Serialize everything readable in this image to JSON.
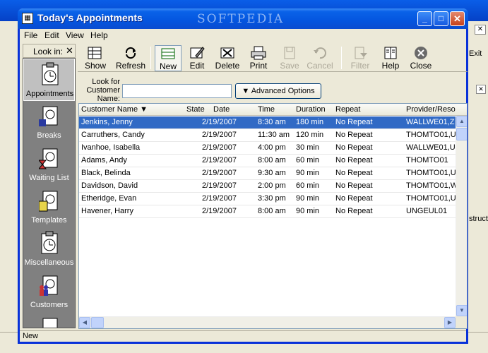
{
  "window": {
    "title": "Today's Appointments",
    "watermark": "SOFTPEDIA",
    "icon": "calendar-app-icon"
  },
  "menu": [
    "File",
    "Edit",
    "View",
    "Help"
  ],
  "lookin": {
    "label": "Look in:",
    "close": "✕"
  },
  "sidebar": [
    {
      "label": "Appointments",
      "icon": "clipboard-clock-icon",
      "selected": true
    },
    {
      "label": "Breaks",
      "icon": "coffee-break-icon"
    },
    {
      "label": "Waiting List",
      "icon": "hourglass-list-icon"
    },
    {
      "label": "Templates",
      "icon": "template-icon"
    },
    {
      "label": "Miscellaneous",
      "icon": "misc-icon"
    },
    {
      "label": "Customers",
      "icon": "customers-icon"
    }
  ],
  "toolbar": {
    "show": "Show",
    "refresh": "Refresh",
    "new": "New",
    "edit": "Edit",
    "delete": "Delete",
    "print": "Print",
    "save": "Save",
    "cancel": "Cancel",
    "filter": "Filter",
    "help": "Help",
    "close": "Close"
  },
  "search": {
    "label": "Look for Customer Name:",
    "value": "",
    "advanced": "Advanced Options"
  },
  "table": {
    "columns": [
      "Customer Name",
      "State",
      "Date",
      "Time",
      "Duration",
      "Repeat",
      "Provider/Reso"
    ],
    "rows": [
      [
        "Jenkins, Jenny",
        "",
        "2/19/2007",
        "8:30 am",
        "180 min",
        "No Repeat",
        "WALLWE01,Z"
      ],
      [
        "Carruthers, Candy",
        "",
        "2/19/2007",
        "11:30 am",
        "120 min",
        "No Repeat",
        "THOMTO01,U"
      ],
      [
        "Ivanhoe, Isabella",
        "",
        "2/19/2007",
        "4:00 pm",
        "30 min",
        "No Repeat",
        "WALLWE01,U"
      ],
      [
        "Adams, Andy",
        "",
        "2/19/2007",
        "8:00 am",
        "60 min",
        "No Repeat",
        "THOMTO01"
      ],
      [
        "Black, Belinda",
        "",
        "2/19/2007",
        "9:30 am",
        "90 min",
        "No Repeat",
        "THOMTO01,U"
      ],
      [
        "Davidson, David",
        "",
        "2/19/2007",
        "2:00 pm",
        "60 min",
        "No Repeat",
        "THOMTO01,W"
      ],
      [
        "Etheridge, Evan",
        "",
        "2/19/2007",
        "3:30 pm",
        "90 min",
        "No Repeat",
        "THOMTO01,U"
      ],
      [
        "Havener, Harry",
        "",
        "2/19/2007",
        "8:00 am",
        "90 min",
        "No Repeat",
        "UNGEUL01"
      ]
    ],
    "selected_row": 0
  },
  "status": "New",
  "background": {
    "exit": "Exit",
    "fragment": "struct"
  }
}
